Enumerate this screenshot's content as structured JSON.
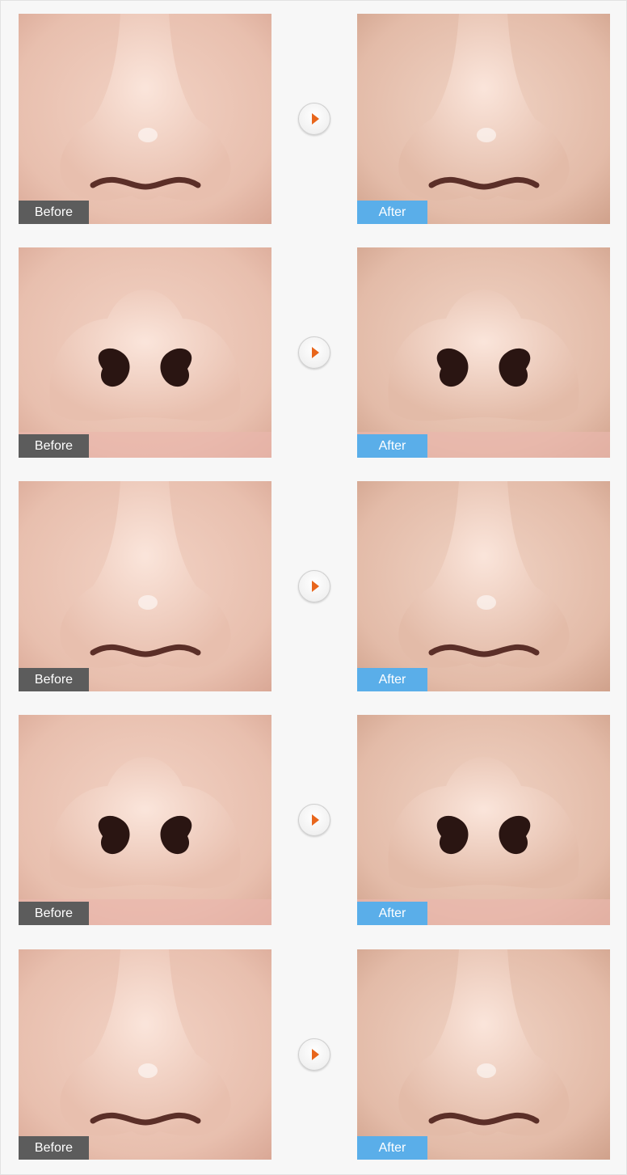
{
  "labels": {
    "before": "Before",
    "after": "After"
  },
  "colors": {
    "before_tag": "#5c5c5c",
    "after_tag": "#5aaee9",
    "arrow": "#e8661c"
  },
  "pairs": [
    {
      "before_view": "front",
      "after_view": "front"
    },
    {
      "before_view": "base",
      "after_view": "base"
    },
    {
      "before_view": "front",
      "after_view": "front"
    },
    {
      "before_view": "base",
      "after_view": "base"
    },
    {
      "before_view": "front",
      "after_view": "front"
    }
  ]
}
